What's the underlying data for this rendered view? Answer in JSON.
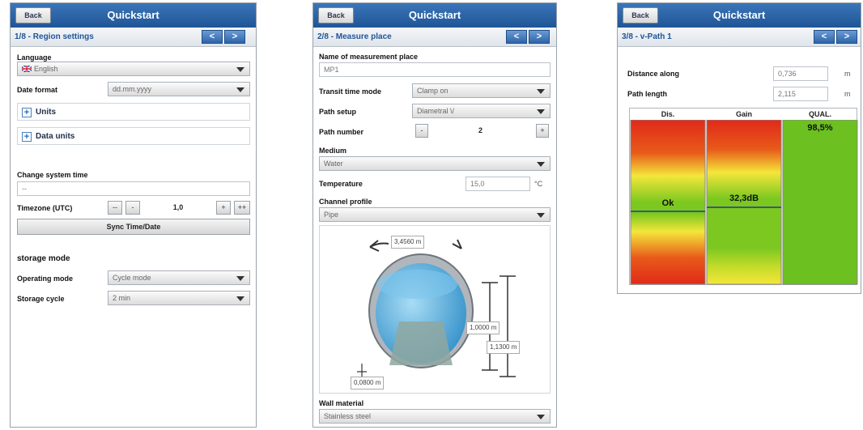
{
  "header": {
    "back_label": "Back",
    "title": "Quickstart"
  },
  "nav": {
    "prev": "<",
    "next": ">"
  },
  "screen1": {
    "step_title": "1/8 - Region settings",
    "language_label": "Language",
    "language_value": "English",
    "date_format_label": "Date format",
    "date_format_value": "dd.mm.yyyy",
    "units_label": "Units",
    "data_units_label": "Data units",
    "change_time_label": "Change system time",
    "system_time_value": "--",
    "timezone_label": "Timezone (UTC)",
    "tz_minus2": "--",
    "tz_minus1": "-",
    "timezone_value": "1,0",
    "tz_plus1": "+",
    "tz_plus2": "++",
    "sync_label": "Sync Time/Date",
    "storage_heading": "storage mode",
    "operating_mode_label": "Operating mode",
    "operating_mode_value": "Cycle mode",
    "storage_cycle_label": "Storage cycle",
    "storage_cycle_value": "2 min"
  },
  "screen2": {
    "step_title": "2/8 - Measure place",
    "name_label": "Name of measurement place",
    "name_value": "MP1",
    "transit_label": "Transit time mode",
    "transit_value": "Clamp on",
    "path_setup_label": "Path setup",
    "path_setup_value": "Diametral \\/",
    "path_number_label": "Path number",
    "path_minus": "-",
    "path_number_value": "2",
    "path_plus": "+",
    "medium_label": "Medium",
    "medium_value": "Water",
    "temperature_label": "Temperature",
    "temperature_value": "15,0",
    "temperature_unit": "°C",
    "channel_label": "Channel profile",
    "channel_value": "Pipe",
    "dim_circumference": "3,4560",
    "dim_inner": "1,0000",
    "dim_outer": "1,1300",
    "dim_wall": "0,0800",
    "dim_unit": "m",
    "wall_label": "Wall material",
    "wall_value": "Stainless steel"
  },
  "screen3": {
    "step_title": "3/8 - v-Path 1",
    "distance_label": "Distance along",
    "distance_value": "0,736",
    "path_length_label": "Path length",
    "path_length_value": "2,115",
    "unit": "m",
    "col_dis": "Dis.",
    "col_gain": "Gain",
    "col_qual": "QUAL.",
    "dis_value": "Ok",
    "gain_value": "32,3dB",
    "qual_value": "98,5%"
  },
  "colors": {
    "header_blue": "#1f5597",
    "quality_green": "#6cc020",
    "warn_red": "#e02a1a",
    "warn_yellow": "#f4e63a"
  }
}
